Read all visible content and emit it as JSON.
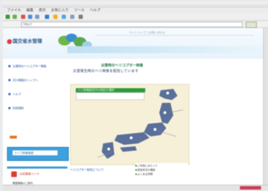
{
  "browser": {
    "menu_items": [
      "ファイル",
      "編集",
      "表示",
      "お気に入り",
      "ツール",
      "ヘルプ"
    ],
    "address_url": "http://",
    "toolbar_icons": [
      "back-icon",
      "forward-icon",
      "stop-icon",
      "refresh-icon",
      "home-icon",
      "search-icon",
      "favorites-icon",
      "history-icon",
      "mail-icon",
      "print-icon"
    ]
  },
  "header": {
    "logo": "国交省水管理",
    "nav_text": "サイトマップ | お問い合わせ"
  },
  "sidebar": {
    "links": [
      "災害時のヘリコプター情報",
      "河川情報のトップへ",
      "ヘルプ",
      "利用規約"
    ],
    "search_box_text": "ライブ映像検索",
    "red_title": "水防関連リンク",
    "small_items": [
      "関連情報のご案内",
      "リンク集・お問い合わせ"
    ]
  },
  "main": {
    "title": "災害時のヘリコプター映像",
    "subtitle": "災害発生時のヘリ映像を配信しています",
    "panel_bar": "ヘリ映像配信中の地区を選択",
    "map_caption": "ヘリコプター配信について",
    "info_lines": [
      "ご利用にあたって",
      "配信状況の確認",
      "よくある質問"
    ]
  },
  "colors": {
    "accent_green": "#2f9a3a",
    "accent_blue": "#3ea0dc",
    "link_blue": "#1a4fa0",
    "map_land": "#5a6f9a",
    "map_background": "#f5f0d7"
  }
}
